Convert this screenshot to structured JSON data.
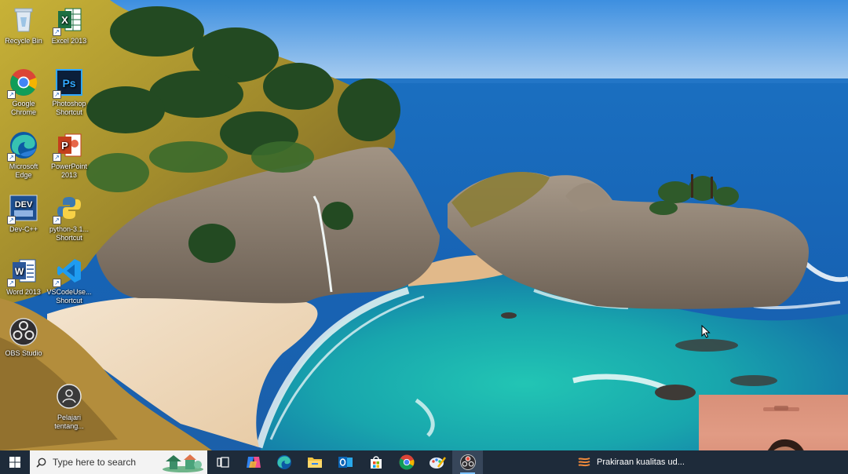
{
  "desktop": {
    "icons": [
      {
        "id": "recycle-bin",
        "label": "Recycle Bin"
      },
      {
        "id": "excel-2013",
        "label": "Excel 2013"
      },
      {
        "id": "google-chrome",
        "label": "Google Chrome"
      },
      {
        "id": "photoshop",
        "label": "Photoshop Shortcut"
      },
      {
        "id": "microsoft-edge",
        "label": "Microsoft Edge"
      },
      {
        "id": "powerpoint-2013",
        "label": "PowerPoint 2013"
      },
      {
        "id": "dev-cpp",
        "label": "Dev-C++"
      },
      {
        "id": "python",
        "label": "python-3.1... Shortcut"
      },
      {
        "id": "word-2013",
        "label": "Word 2013"
      },
      {
        "id": "vscode",
        "label": "VSCodeUse... Shortcut"
      },
      {
        "id": "obs-studio",
        "label": "OBS Studio"
      },
      {
        "id": "pelajari",
        "label": "Pelajari tentang..."
      }
    ]
  },
  "taskbar": {
    "search_placeholder": "Type here to search",
    "apps": [
      "task-view",
      "copilot",
      "edge",
      "file-explorer",
      "outlook",
      "microsoft-store",
      "chrome",
      "paint",
      "obs-studio"
    ],
    "news_text": "Prakiraan kualitas ud..."
  },
  "colors": {
    "taskbar_bg": "#1e2b3a",
    "search_bg": "#f3f3f3",
    "accent": "#7cc0ff"
  }
}
